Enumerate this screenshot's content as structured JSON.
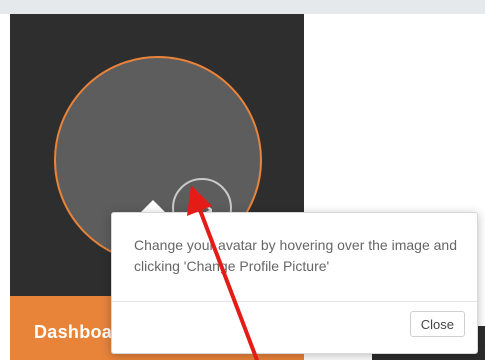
{
  "sidebar": {
    "footer_label": "Dashboa"
  },
  "avatar": {
    "upload_icon": "upload-tray-icon"
  },
  "popover": {
    "message": "Change your avatar by hovering over the image and clicking 'Change Profile Picture'",
    "close_label": "Close"
  },
  "annotation": {
    "arrow_color": "#e41b17"
  },
  "colors": {
    "accent": "#e8833a",
    "sidebar_bg": "#2e2e2e",
    "avatar_bg": "#5d5d5d"
  }
}
